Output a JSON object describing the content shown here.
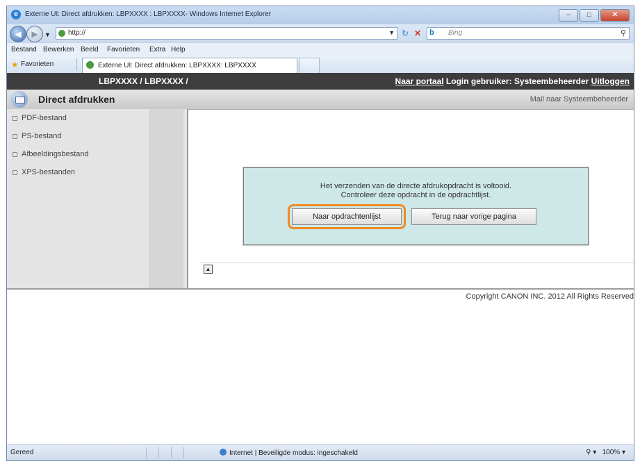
{
  "browser": {
    "window_title": "Externe UI: Direct afdrukken: LBPXXXX : LBPXXXX- Windows Internet Explorer",
    "window_buttons": {
      "minimize": "–",
      "maximize": "□",
      "close": "✕"
    },
    "address": "http://",
    "search_placeholder": "Bing",
    "search_brand": "b",
    "menu": [
      "Bestand",
      "Bewerken",
      "Beeld",
      "Favorieten",
      "Extra",
      "Help"
    ],
    "favorites_label": "Favorieten",
    "tab_title": "Externe UI: Direct afdrukken: LBPXXXX: LBPXXXX",
    "status_left": "Gereed",
    "status_zone": "Internet | Beveiligde modus: ingeschakeld",
    "zoom": "100%"
  },
  "header": {
    "device": "LBPXXXX / LBPXXXX /",
    "portal_link": "Naar portaal",
    "login_text": "Login gebruiker: Systeembeheerder",
    "logout_link": "Uitloggen"
  },
  "subheader": {
    "title": "Direct afdrukken",
    "mail_link": "Mail naar Systeembeheerder"
  },
  "sidebar": {
    "items": [
      {
        "label": "PDF-bestand"
      },
      {
        "label": "PS-bestand"
      },
      {
        "label": "Afbeeldingsbestand"
      },
      {
        "label": "XPS-bestanden"
      }
    ]
  },
  "dialog": {
    "line1": "Het verzenden van de directe afdrukopdracht is voltooid.",
    "line2": "Controleer deze opdracht in de opdrachtlijst.",
    "btn_joblist": "Naar opdrachtenlijst",
    "btn_back": "Terug naar vorige pagina"
  },
  "footer": {
    "copyright": "Copyright CANON INC. 2012 All Rights Reserved"
  },
  "colors": {
    "highlight": "#f08a24",
    "dialog_bg": "#cde8e6",
    "header_bg": "#3d3d3d"
  }
}
